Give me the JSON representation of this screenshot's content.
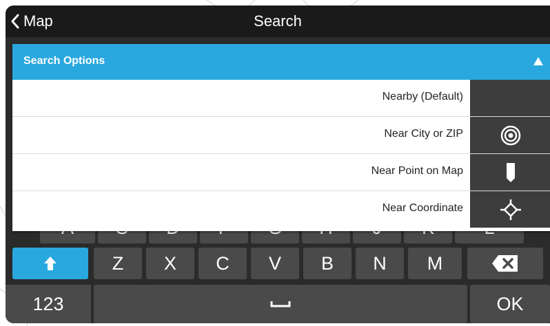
{
  "titlebar": {
    "back_label": "Map",
    "title": "Search"
  },
  "search_options": {
    "header": "Search Options",
    "options": [
      {
        "label": "Nearby (Default)",
        "icon": "none"
      },
      {
        "label": "Near City or ZIP",
        "icon": "target-icon"
      },
      {
        "label": "Near Point on Map",
        "icon": "map-pin-icon"
      },
      {
        "label": "Near Coordinate",
        "icon": "crosshair-icon"
      }
    ]
  },
  "keyboard": {
    "row_letters_partial": [
      "A",
      "S",
      "D",
      "F",
      "G",
      "H",
      "J",
      "K",
      "L"
    ],
    "row_bottom_letters": [
      "Z",
      "X",
      "C",
      "V",
      "B",
      "N",
      "M"
    ],
    "numbers_key": "123",
    "ok_key": "OK"
  },
  "colors": {
    "accent": "#29a8e0",
    "titlebar": "#1a1a1a",
    "keyboard_bg": "#2b2b2b",
    "key_bg": "#4a4a4a",
    "icon_column": "#3d3d3d"
  }
}
